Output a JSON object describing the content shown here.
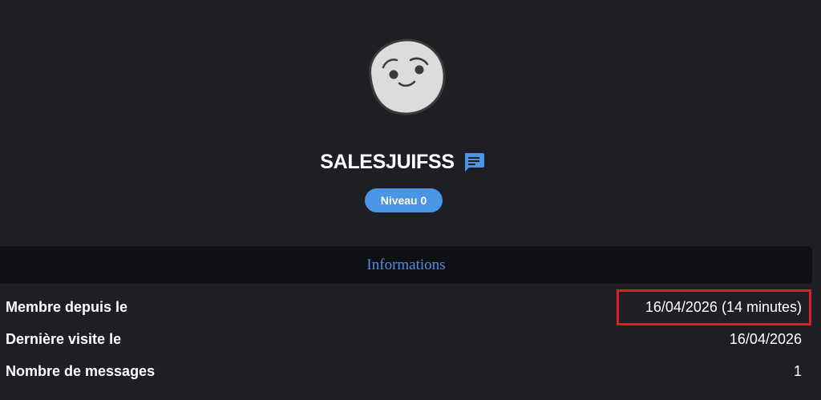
{
  "profile": {
    "username": "SALESJUIFSS",
    "level_badge": "Niveau 0",
    "avatar_icon": "smiley-face-avatar",
    "message_icon": "chat-message-icon"
  },
  "info": {
    "title": "Informations",
    "rows": [
      {
        "label": "Membre depuis le",
        "value": "16/04/2026 (14 minutes)",
        "highlighted": true
      },
      {
        "label": "Dernière visite le",
        "value": "16/04/2026"
      },
      {
        "label": "Nombre de messages",
        "value": "1"
      }
    ]
  },
  "colors": {
    "background": "#1e1f25",
    "header_bg": "#0f1013",
    "accent": "#4a95e6",
    "highlight": "#e01b24"
  }
}
